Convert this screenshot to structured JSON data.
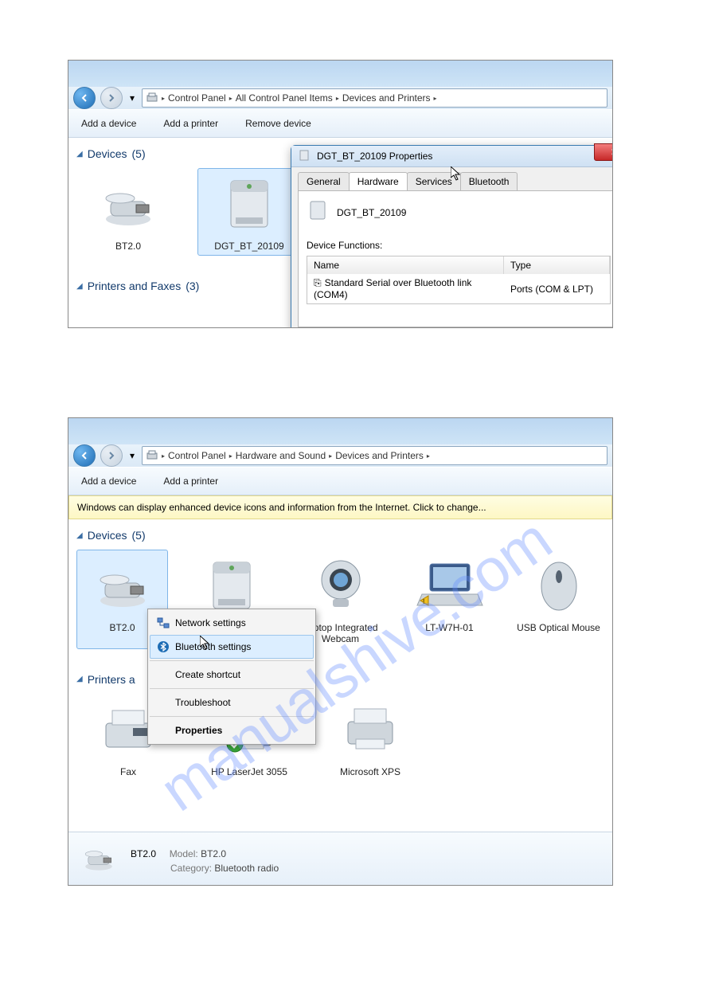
{
  "watermark": "manualshive.com",
  "shot1": {
    "breadcrumbs": [
      "Control Panel",
      "All Control Panel Items",
      "Devices and Printers"
    ],
    "toolbar": {
      "add_device": "Add a device",
      "add_printer": "Add a printer",
      "remove_device": "Remove device"
    },
    "devices_header": "Devices",
    "devices_count": "(5)",
    "devices": [
      {
        "label": "BT2.0"
      },
      {
        "label": "DGT_BT_20109"
      }
    ],
    "printers_header": "Printers and Faxes",
    "printers_count": "(3)",
    "dialog": {
      "title": "DGT_BT_20109 Properties",
      "tabs": {
        "general": "General",
        "hardware": "Hardware",
        "services": "Services",
        "bluetooth": "Bluetooth"
      },
      "device_name": "DGT_BT_20109",
      "funcs_label": "Device Functions:",
      "col_name": "Name",
      "col_type": "Type",
      "row_name": "Standard Serial over Bluetooth link (COM4)",
      "row_type": "Ports (COM & LPT)"
    }
  },
  "shot2": {
    "breadcrumbs": [
      "Control Panel",
      "Hardware and Sound",
      "Devices and Printers"
    ],
    "toolbar": {
      "add_device": "Add a device",
      "add_printer": "Add a printer"
    },
    "infobar": "Windows can display enhanced device icons and information from the Internet. Click to change...",
    "devices_header": "Devices",
    "devices_count": "(5)",
    "devices": [
      {
        "label": "BT2.0"
      },
      {
        "label": ""
      },
      {
        "label": "Laptop Integrated Webcam"
      },
      {
        "label": "LT-W7H-01"
      },
      {
        "label": "USB Optical Mouse"
      }
    ],
    "ctx": {
      "network": "Network settings",
      "bluetooth": "Bluetooth settings",
      "shortcut": "Create shortcut",
      "troubleshoot": "Troubleshoot",
      "properties": "Properties"
    },
    "printers_header": "Printers a",
    "printers_count": "",
    "printers": [
      {
        "label": "Fax"
      },
      {
        "label": "HP LaserJet 3055"
      },
      {
        "label": "Microsoft XPS"
      }
    ],
    "detail": {
      "name": "BT2.0",
      "model_label": "Model:",
      "model": "BT2.0",
      "category_label": "Category:",
      "category": "Bluetooth radio"
    }
  }
}
